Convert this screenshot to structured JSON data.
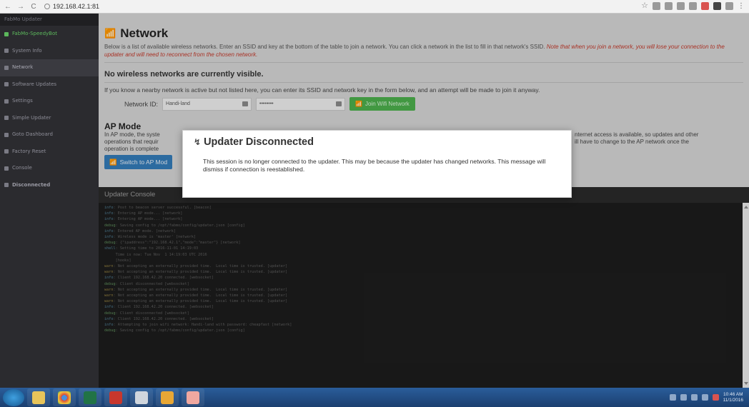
{
  "browser": {
    "url": "192.168.42.1:81",
    "nav": {
      "back": "←",
      "forward": "→",
      "reload": "C"
    }
  },
  "sidebar": {
    "title": "FabMo Updater",
    "items": [
      {
        "label": "FabMo-SpeedyBot",
        "icon": "tool-icon",
        "style": "green"
      },
      {
        "label": "System Info",
        "icon": "info-icon",
        "style": ""
      },
      {
        "label": "Network",
        "icon": "wifi-icon",
        "style": "active"
      },
      {
        "label": "Software Updates",
        "icon": "download-icon",
        "style": ""
      },
      {
        "label": "Settings",
        "icon": "wrench-icon",
        "style": ""
      },
      {
        "label": "Simple Updater",
        "icon": "upload-icon",
        "style": ""
      },
      {
        "label": "Goto Dashboard",
        "icon": "dashboard-icon",
        "style": ""
      },
      {
        "label": "Factory Reset",
        "icon": "reset-icon",
        "style": ""
      },
      {
        "label": "Console",
        "icon": "terminal-icon",
        "style": ""
      },
      {
        "label": "Disconnected",
        "icon": "disconnect-icon",
        "style": "bold"
      }
    ]
  },
  "network": {
    "title": "Network",
    "description": "Below is a list of available wireless networks. Enter an SSID and key at the bottom of the table to join a network. You can click a network in the list to fill in that network's SSID.",
    "description_note": "Note that when you join a network, you will lose your connection to the updater and will need to reconnect from the chosen network.",
    "no_networks": "No wireless networks are currently visible.",
    "hint": "If you know a nearby network is active but not listed here, you can enter its SSID and network key in the form below, and an attempt will be made to join it anyway.",
    "network_id_label": "Network ID:",
    "ssid_value": "Handi-land",
    "key_value": "••••••••",
    "join_button": "Join Wifi Network"
  },
  "ap_mode": {
    "title": "AP Mode",
    "text_left": "In AP mode, the syste",
    "text_left2": "operations that requir",
    "text_left3": "operation is complete",
    "text_right": "nternet access is available, so updates and other",
    "text_right2": "ill have to change to the AP network once the",
    "button": "Switch to AP Mod"
  },
  "console": {
    "title": "Updater Console",
    "lines": [
      {
        "level": "info",
        "text": "Post to beacon server successful. [beacon]"
      },
      {
        "level": "info",
        "text": "Entering AP mode... [network]"
      },
      {
        "level": "info",
        "text": "Entering AP mode... [network]"
      },
      {
        "level": "debug",
        "text": "Saving config to /opt/fabmo/config/updater.json [config]"
      },
      {
        "level": "info",
        "text": "Entered AP mode. [network]"
      },
      {
        "level": "info",
        "text": "Wireless mode is 'master' [network]"
      },
      {
        "level": "debug",
        "text": "{\"ipaddress\":\"192.168.42.1\",\"mode\":\"master\"} [network]"
      },
      {
        "level": "shell",
        "text": "Setting time to 2016-11-01 14:19:03"
      },
      {
        "level": "cont",
        "text": "     Time is now: Tue Nov  1 14:19:03 UTC 2016"
      },
      {
        "level": "cont",
        "text": "     [hooks]"
      },
      {
        "level": "warn",
        "text": "Not accepting an externally provided time.  Local time is trusted. [updater]"
      },
      {
        "level": "warn",
        "text": "Not accepting an externally provided time.  Local time is trusted. [updater]"
      },
      {
        "level": "info",
        "text": "Client 192.168.42.20 connected. [websocket]"
      },
      {
        "level": "debug",
        "text": "Client disconnected [websocket]"
      },
      {
        "level": "warn",
        "text": "Not accepting an externally provided time.  Local time is trusted. [updater]"
      },
      {
        "level": "warn",
        "text": "Not accepting an externally provided time.  Local time is trusted. [updater]"
      },
      {
        "level": "warn",
        "text": "Not accepting an externally provided time.  Local time is trusted. [updater]"
      },
      {
        "level": "info",
        "text": "Client 192.168.42.20 connected. [websocket]"
      },
      {
        "level": "debug",
        "text": "Client disconnected [websocket]"
      },
      {
        "level": "info",
        "text": "Client 192.168.42.20 connected. [websocket]"
      },
      {
        "level": "info",
        "text": "Attempting to join wifi network: Handi-land with password: cheapfast [network]"
      },
      {
        "level": "debug",
        "text": "Saving config to /opt/fabmo/config/updater.json [config]"
      }
    ]
  },
  "modal": {
    "title": "Updater Disconnected",
    "body": "This session is no longer connected to the updater. This may be because the updater has changed networks. This message will dismiss if connection is reestablished."
  },
  "taskbar": {
    "time": "10:46 AM",
    "date": "11/1/2016"
  }
}
